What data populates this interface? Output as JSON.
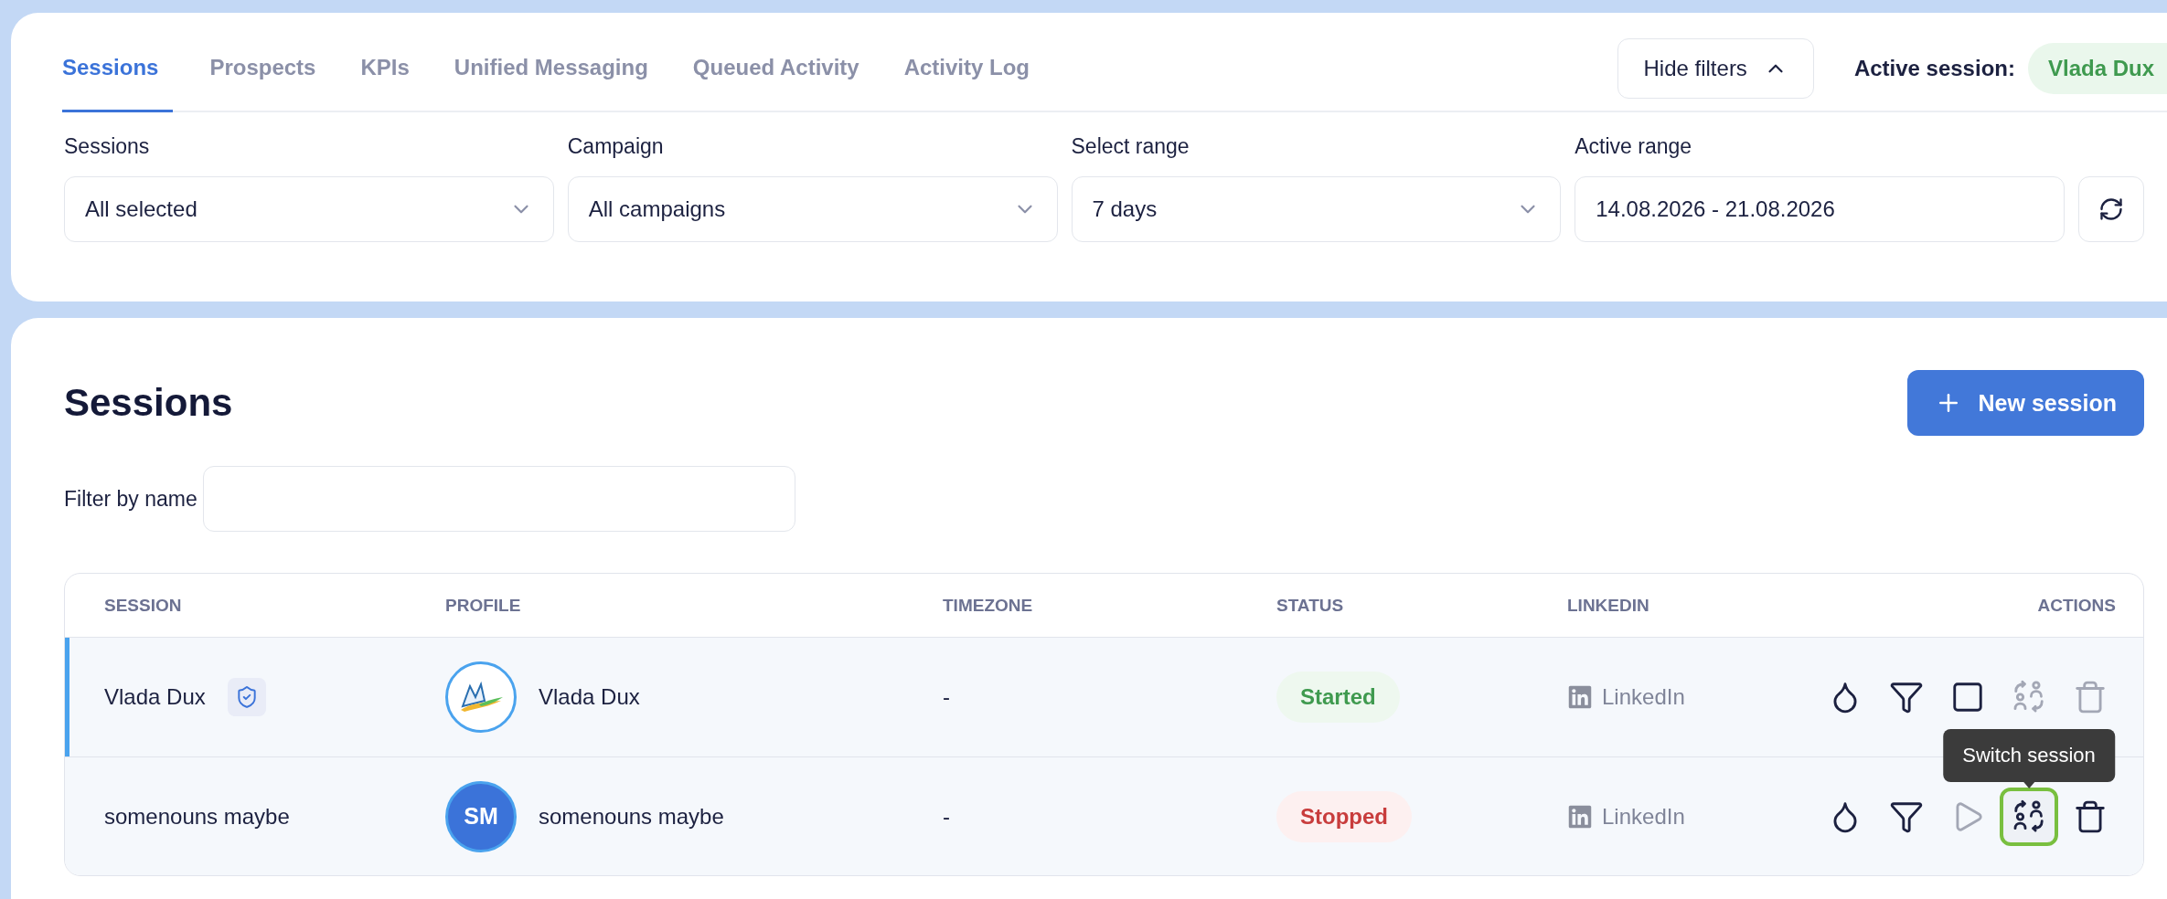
{
  "tabs": [
    {
      "label": "Sessions",
      "selected": true
    },
    {
      "label": "Prospects",
      "selected": false
    },
    {
      "label": "KPIs",
      "selected": false
    },
    {
      "label": "Unified Messaging",
      "selected": false
    },
    {
      "label": "Queued Activity",
      "selected": false
    },
    {
      "label": "Activity Log",
      "selected": false
    }
  ],
  "hide_filters_button": "Hide filters",
  "active_session": {
    "label": "Active session:",
    "name": "Vlada Dux"
  },
  "filters": [
    {
      "label": "Sessions",
      "value": "All selected",
      "kind": "select"
    },
    {
      "label": "Campaign",
      "value": "All campaigns",
      "kind": "select"
    },
    {
      "label": "Select range",
      "value": "7 days",
      "kind": "select"
    },
    {
      "label": "Active range",
      "value": "14.08.2026 - 21.08.2026",
      "kind": "text"
    }
  ],
  "sessions_panel": {
    "title": "Sessions",
    "new_button": "New session",
    "filter_label": "Filter by name"
  },
  "table": {
    "columns": [
      "SESSION",
      "PROFILE",
      "TIMEZONE",
      "STATUS",
      "LINKEDIN",
      "ACTIONS"
    ],
    "rows": [
      {
        "session": "Vlada Dux",
        "active": true,
        "protected": true,
        "profile": {
          "name": "Vlada Dux",
          "kind": "logo"
        },
        "timezone": "-",
        "status": {
          "label": "Started",
          "kind": "started"
        },
        "linkedin": "LinkedIn",
        "actions": [
          {
            "kind": "drop",
            "disabled": false,
            "focused": false
          },
          {
            "kind": "funnel",
            "disabled": false,
            "focused": false
          },
          {
            "kind": "stop",
            "disabled": false,
            "focused": false
          },
          {
            "kind": "switch",
            "disabled": true,
            "focused": false
          },
          {
            "kind": "delete",
            "disabled": true,
            "focused": false
          }
        ]
      },
      {
        "session": "somenouns maybe",
        "active": false,
        "protected": false,
        "profile": {
          "name": "somenouns maybe",
          "kind": "initials",
          "initials": "SM"
        },
        "timezone": "-",
        "status": {
          "label": "Stopped",
          "kind": "stopped"
        },
        "linkedin": "LinkedIn",
        "actions": [
          {
            "kind": "drop",
            "disabled": false,
            "focused": false
          },
          {
            "kind": "funnel",
            "disabled": false,
            "focused": false
          },
          {
            "kind": "play",
            "disabled": true,
            "focused": false
          },
          {
            "kind": "switch",
            "disabled": false,
            "focused": true,
            "tooltip": "Switch session"
          },
          {
            "kind": "delete",
            "disabled": false,
            "focused": false
          }
        ]
      }
    ]
  }
}
